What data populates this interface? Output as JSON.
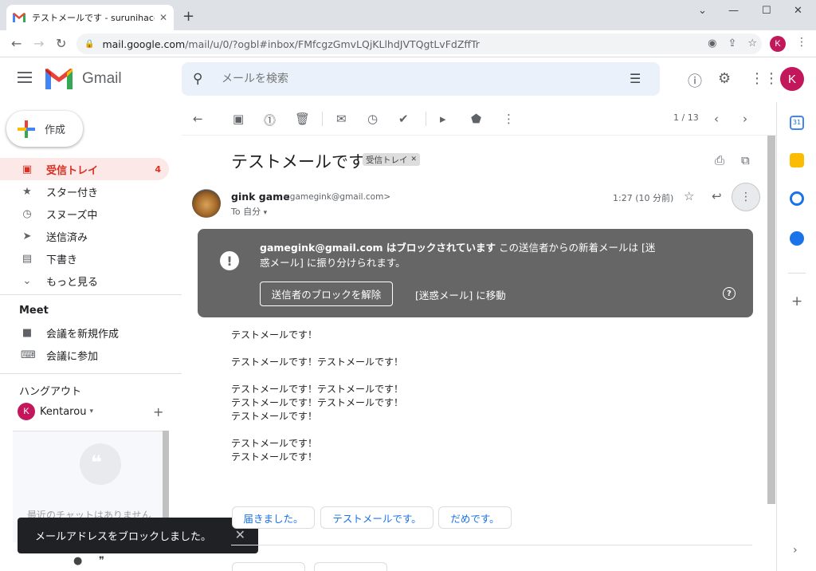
{
  "browser": {
    "tab_title": "テストメールです - surunihacom@gmail",
    "url_main": "mail.google.com",
    "url_rest": "/mail/u/0/?ogbl#inbox/FMfcgzGmvLQjKLlhdJVTQgtLvFdZffTr",
    "profile_initial": "K"
  },
  "header": {
    "app_name": "Gmail",
    "search_placeholder": "メールを検索",
    "avatar_initial": "K"
  },
  "nav": {
    "compose_label": "作成",
    "items": [
      {
        "label": "受信トレイ",
        "count": "4",
        "icon": "inbox-icon"
      },
      {
        "label": "スター付き",
        "icon": "star-icon"
      },
      {
        "label": "スヌーズ中",
        "icon": "clock-icon"
      },
      {
        "label": "送信済み",
        "icon": "send-icon"
      },
      {
        "label": "下書き",
        "icon": "draft-icon"
      },
      {
        "label": "もっと見る",
        "icon": "chevron-down-icon"
      }
    ],
    "meet_heading": "Meet",
    "meet_items": [
      {
        "label": "会議を新規作成",
        "icon": "video-icon"
      },
      {
        "label": "会議に参加",
        "icon": "keyboard-icon"
      }
    ],
    "hangouts_heading": "ハングアウト",
    "hangouts_user": "Kentarou",
    "hangouts_initial": "K",
    "no_chat_text": "最近のチャットはありません"
  },
  "toast": {
    "message": "メールアドレスをブロックしました。"
  },
  "toolbar": {
    "pager": "1 / 13"
  },
  "message": {
    "subject": "テストメールです",
    "label_chip": "受信トレイ",
    "sender_name": "gink game",
    "sender_email": "<gamegink@gmail.com>",
    "to_line": "To 自分",
    "time": "1:27 (10 分前)",
    "body": [
      "テストメールです！",
      "",
      "テストメールです！テストメールです！",
      "",
      "テストメールです！テストメールです！",
      "テストメールです！テストメールです！",
      "テストメールです！",
      "",
      "テストメールです！",
      "テストメールです！"
    ]
  },
  "banner": {
    "bold_text": "gamegink@gmail.com はブロックされています",
    "rest_text": " この送信者からの新着メールは [迷惑メール] に振り分けられます。",
    "unblock_button": "送信者のブロックを解除",
    "move_to_spam": "[迷惑メール] に移動"
  },
  "smart_replies": [
    "届きました。",
    "テストメールです。",
    "だめです。"
  ],
  "colors": {
    "gmail_red": "#d93025",
    "banner_bg": "#666666",
    "avatar": "#c2185b",
    "link_blue": "#1a73e8"
  }
}
